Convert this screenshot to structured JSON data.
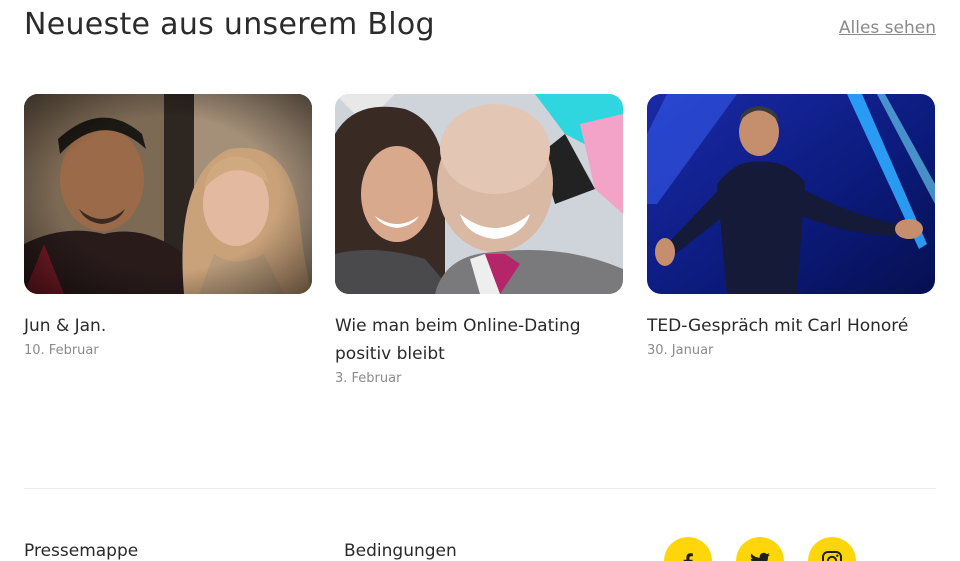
{
  "blog": {
    "title": "Neueste aus unserem Blog",
    "see_all_label": "Alles sehen",
    "posts": [
      {
        "title": "Jun & Jan.",
        "date": "10. Februar",
        "image": "selfie-couple-photo"
      },
      {
        "title": "Wie man beim Online-Dating positiv bleibt",
        "date": "3. Februar",
        "image": "smiling-couple-photo"
      },
      {
        "title": "TED-Gespräch mit Carl Honoré",
        "date": "30. Januar",
        "image": "speaker-on-stage-photo"
      }
    ]
  },
  "footer": {
    "press_label": "Pressemappe",
    "terms_label": "Bedingungen",
    "social": [
      {
        "icon": "facebook-icon"
      },
      {
        "icon": "twitter-icon"
      },
      {
        "icon": "instagram-icon"
      }
    ],
    "social_color": "#ffd60a"
  }
}
